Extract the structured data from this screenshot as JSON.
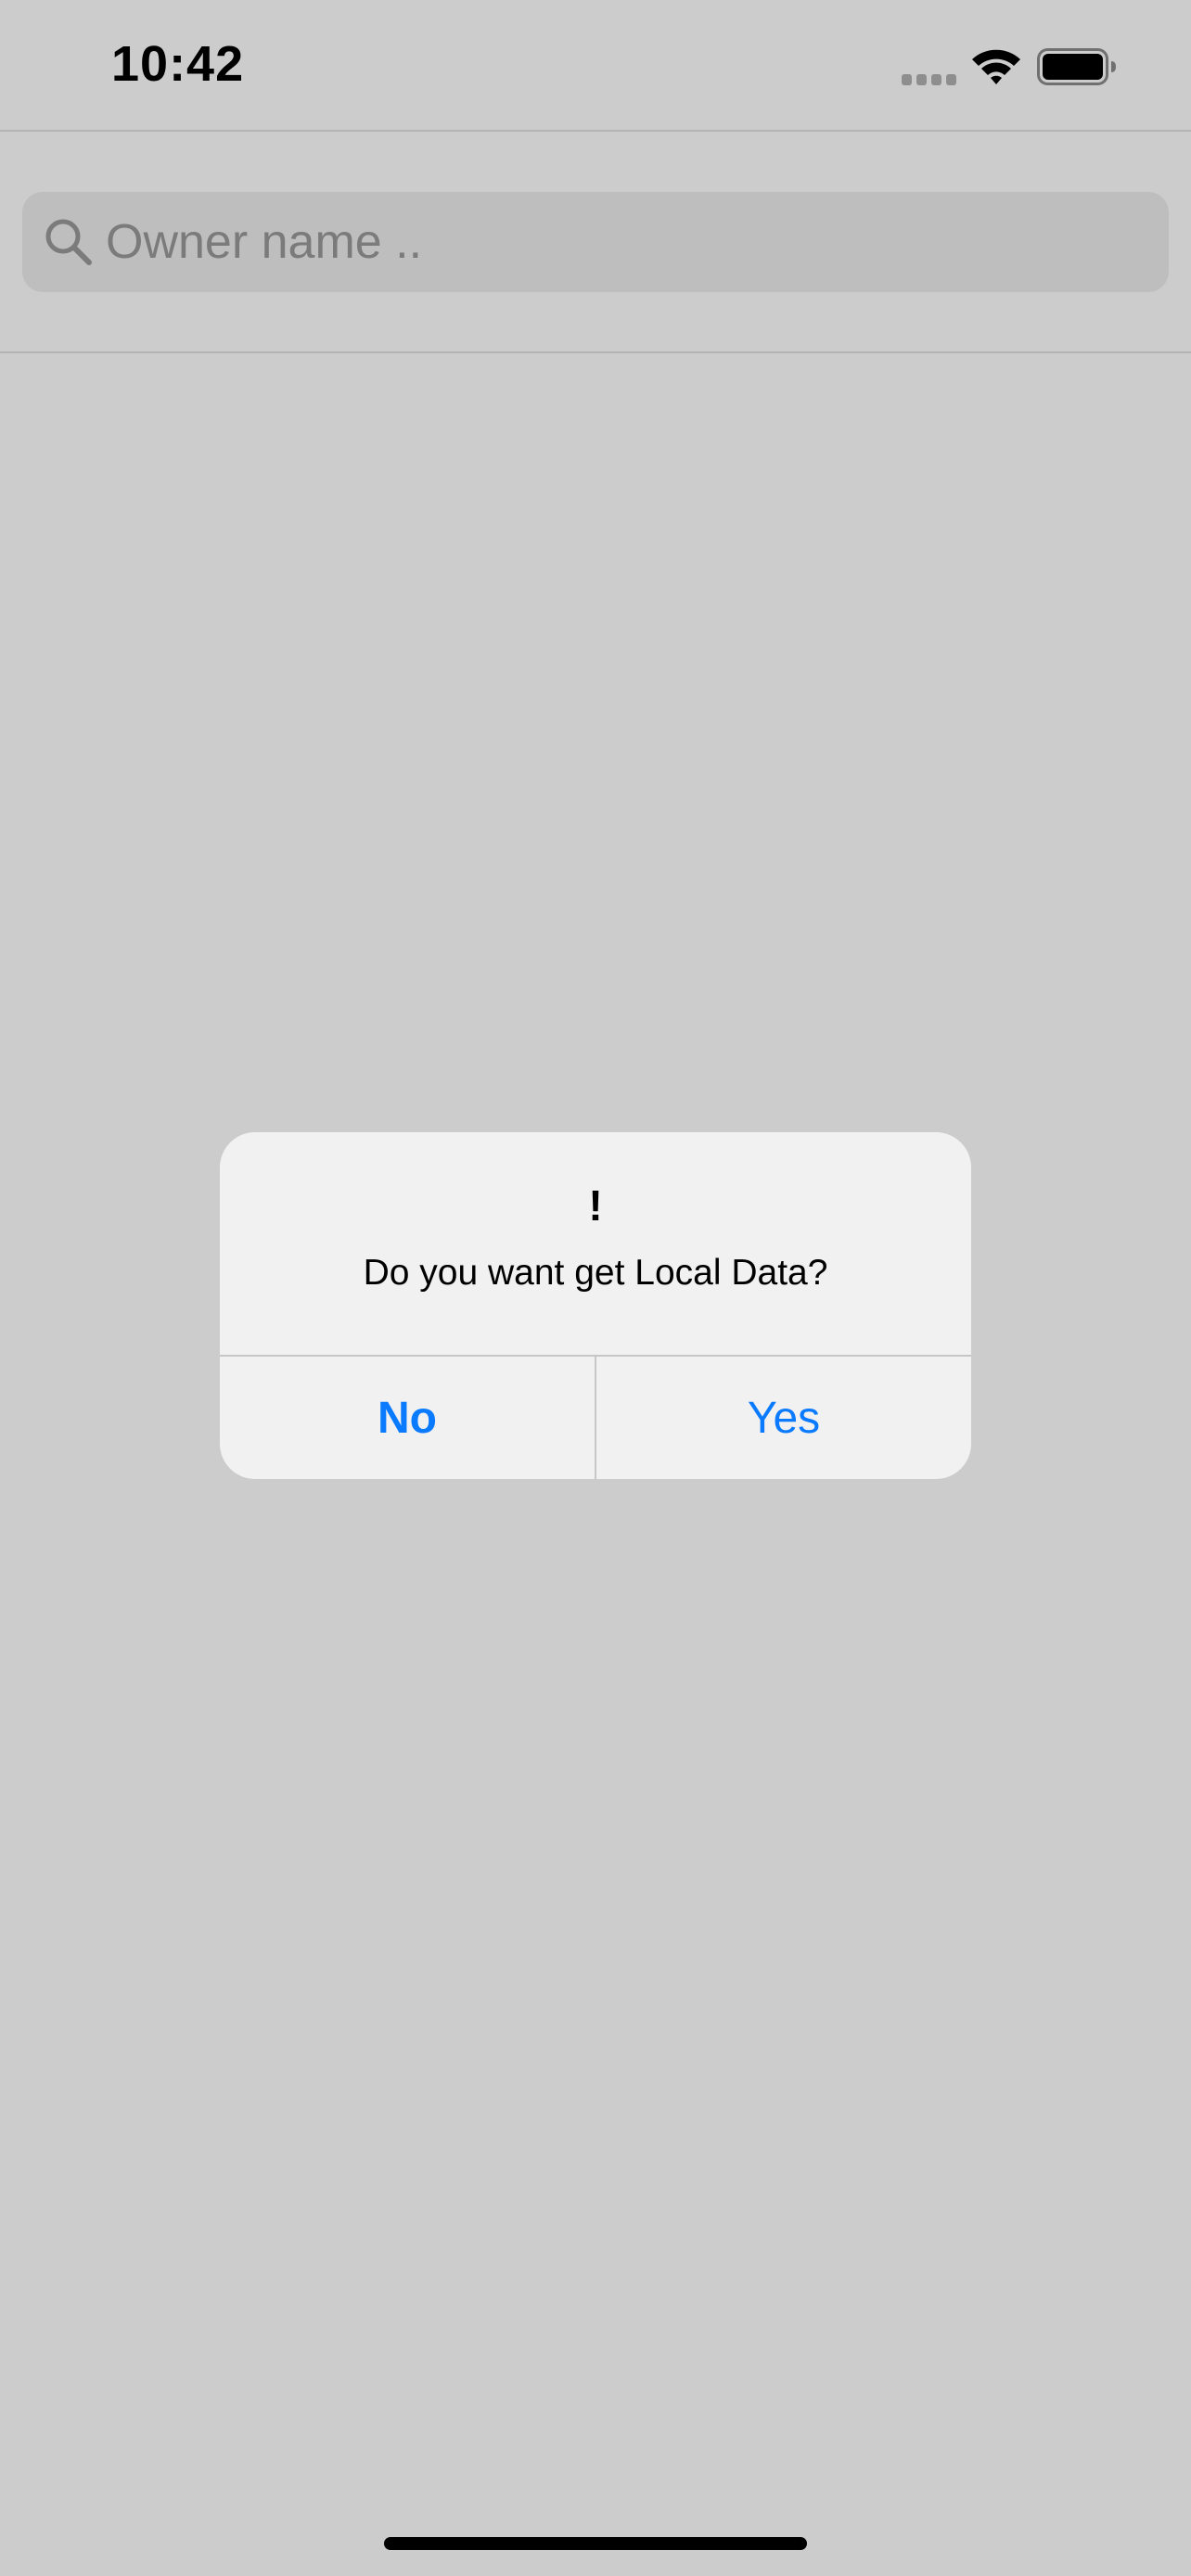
{
  "status_bar": {
    "time": "10:42",
    "cellular_icon": "cellular-signal-icon",
    "wifi_icon": "wifi-icon",
    "battery_icon": "battery-icon"
  },
  "search": {
    "placeholder": "Owner name ..",
    "value": "",
    "icon": "search-icon"
  },
  "alert": {
    "title": "!",
    "message": "Do you want get Local Data?",
    "buttons": {
      "no": "No",
      "yes": "Yes"
    },
    "accent_color": "#0a7aff"
  },
  "colors": {
    "background": "#cccccc",
    "alert_background": "#f1f1f1"
  }
}
